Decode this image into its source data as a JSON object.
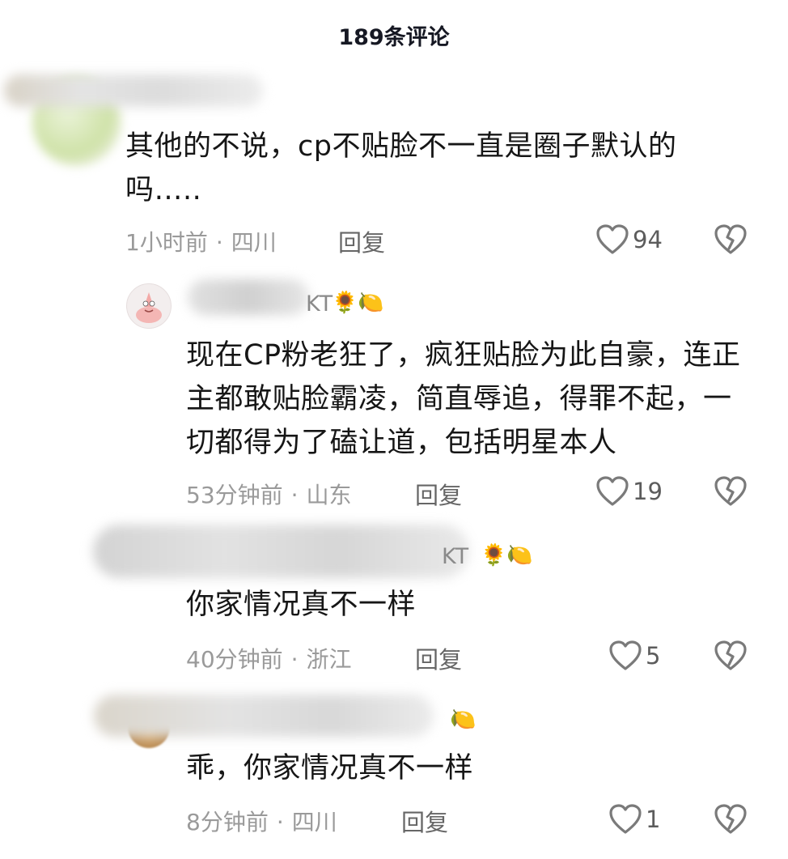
{
  "header": {
    "title": "189条评论"
  },
  "colors": {
    "text": "#161616",
    "meta": "#9a9a9a",
    "icon": "#7a7a7a"
  },
  "comments": [
    {
      "username": "",
      "text": "其他的不说，cp不贴脸不一直是圈子默认的吗…..",
      "time": "1小时前",
      "location": "四川",
      "reply_label": "回复",
      "likes": "94",
      "avatar_icon": "blurred-avatar"
    },
    {
      "username": "KT",
      "badges": "🌻🍋",
      "text": "现在CP粉老狂了，疯狂贴脸为此自豪，连正主都敢贴脸霸凌，简直辱追，得罪不起，一切都得为了磕让道，包括明星本人",
      "time": "53分钟前",
      "location": "山东",
      "reply_label": "回复",
      "likes": "19",
      "avatar_icon": "patrick-star-avatar"
    },
    {
      "username": "KT",
      "badges": "🌻🍋",
      "text": "你家情况真不一样",
      "time": "40分钟前",
      "location": "浙江",
      "reply_label": "回复",
      "likes": "5",
      "avatar_icon": "blurred-avatar"
    },
    {
      "username": "",
      "badges": "🍋",
      "text": "乖，你家情况真不一样",
      "time": "8分钟前",
      "location": "四川",
      "reply_label": "回复",
      "likes": "1",
      "avatar_icon": "blurred-avatar"
    }
  ]
}
